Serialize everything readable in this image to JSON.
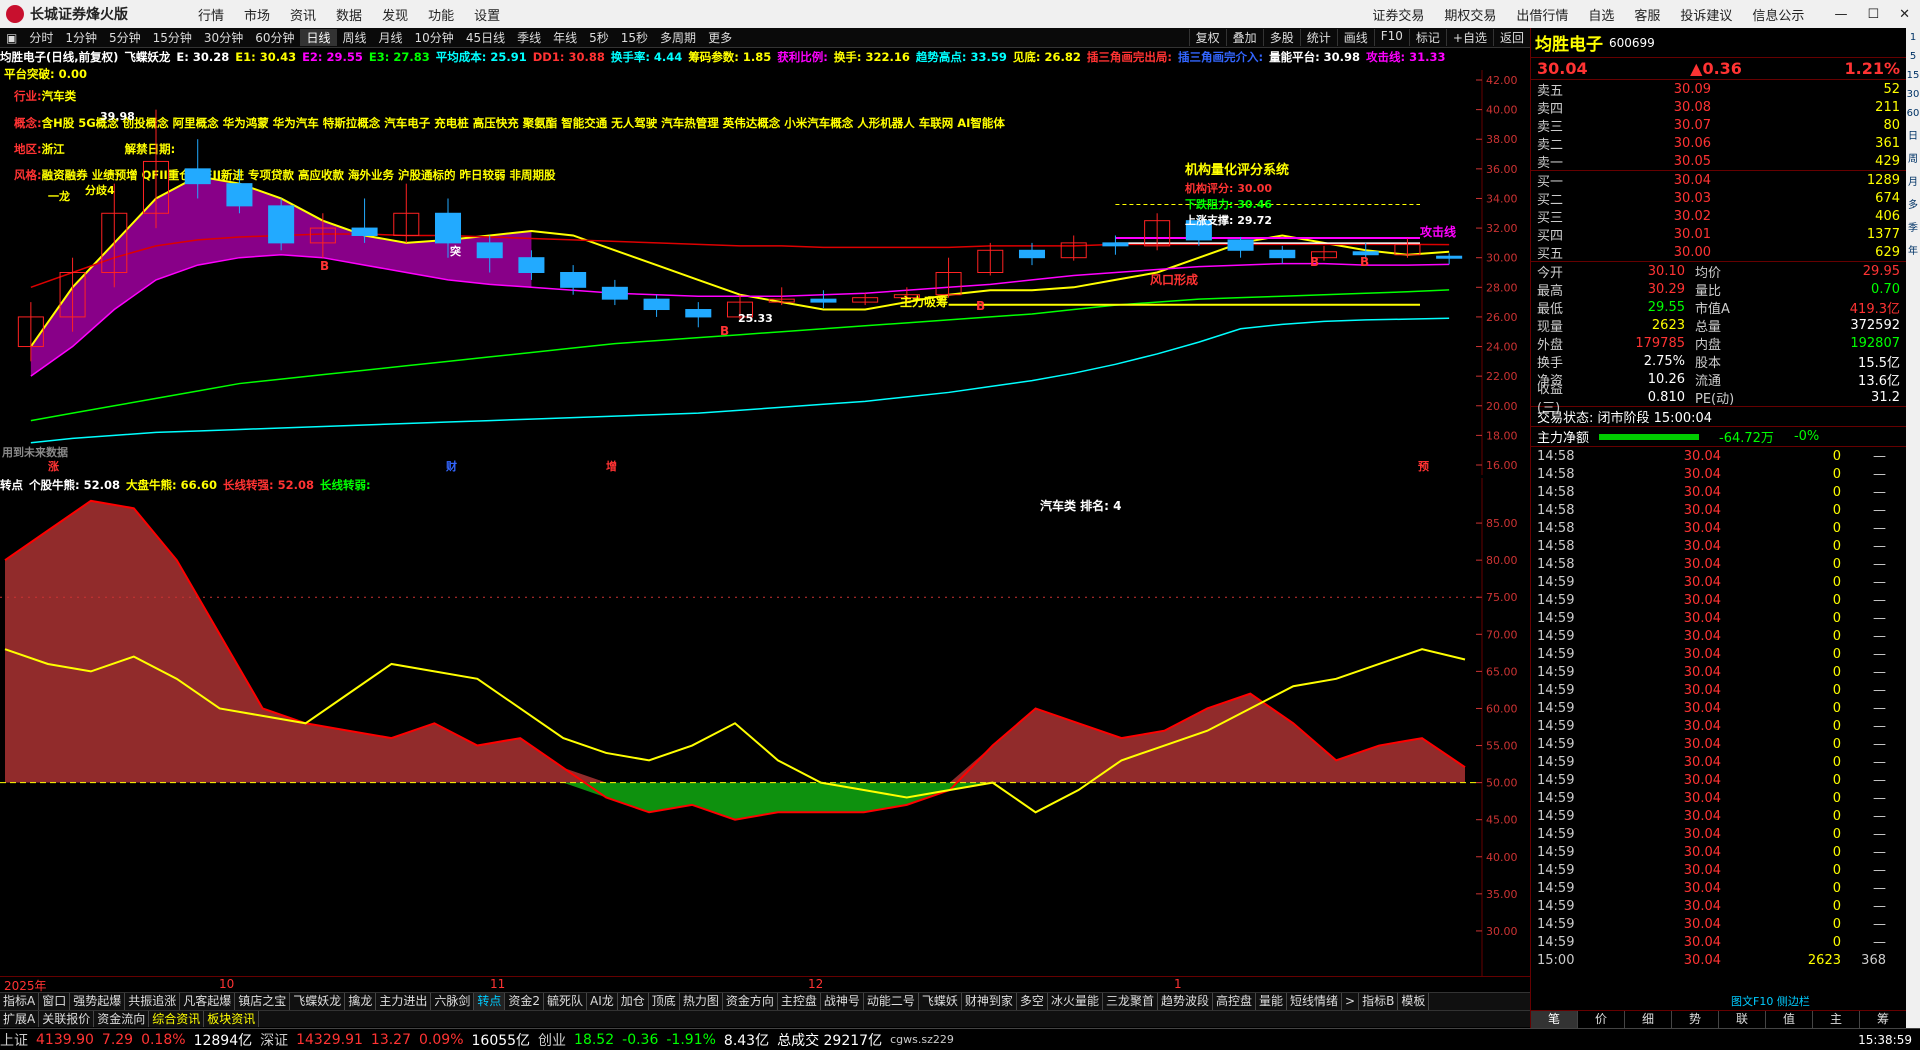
{
  "app": {
    "title": "长城证券烽火版"
  },
  "menu": [
    "行情",
    "市场",
    "资讯",
    "数据",
    "发现",
    "功能",
    "设置"
  ],
  "menu_right": [
    "证券交易",
    "期权交易",
    "出借行情",
    "自选",
    "客服",
    "投诉建议",
    "信息公示"
  ],
  "periods": [
    "分时",
    "1分钟",
    "5分钟",
    "15分钟",
    "30分钟",
    "60分钟",
    "日线",
    "周线",
    "月线",
    "10分钟",
    "45日线",
    "季线",
    "年线",
    "5秒",
    "15秒",
    "多周期",
    "更多"
  ],
  "active_period": "日线",
  "toolbar_right": [
    "复权",
    "叠加",
    "多股",
    "统计",
    "画线",
    "F10",
    "标记",
    "+自选",
    "返回"
  ],
  "indicator_line": [
    {
      "t": "均胜电子(日线,前复权)",
      "c": "#fff"
    },
    {
      "t": "飞蝶妖龙",
      "c": "#fff"
    },
    {
      "t": "E: 30.28",
      "c": "#fff"
    },
    {
      "t": "E1: 30.43",
      "c": "#ff0"
    },
    {
      "t": "E2: 29.55",
      "c": "#f0f"
    },
    {
      "t": "E3: 27.83",
      "c": "#0f0"
    },
    {
      "t": "平均成本: 25.91",
      "c": "#0ff"
    },
    {
      "t": "DD1: 30.88",
      "c": "#f33"
    },
    {
      "t": "换手率: 4.44",
      "c": "#0ff"
    },
    {
      "t": "筹码参数: 1.85",
      "c": "#ff0"
    },
    {
      "t": "获利比例:",
      "c": "#f0f"
    },
    {
      "t": "换手: 322.16",
      "c": "#ff0"
    },
    {
      "t": "趋势高点: 33.59",
      "c": "#0ff"
    },
    {
      "t": "见底: 26.82",
      "c": "#ff0"
    },
    {
      "t": "插三角画完出局:",
      "c": "#f33"
    },
    {
      "t": "插三角画完介入:",
      "c": "#36f"
    },
    {
      "t": "量能平台: 30.98",
      "c": "#fff"
    },
    {
      "t": "攻击线: 31.33",
      "c": "#f0f"
    }
  ],
  "platform": "平台突破: 0.00",
  "info": {
    "industry_k": "行业:",
    "industry_v": "汽车类",
    "concept_k": "概念:",
    "concept_v": "含H股 5G概念 创投概念 阿里概念 华为鸿蒙 华为汽车 特斯拉概念 汽车电子 充电桩 高压快充 聚氨酯 智能交通 无人驾驶 汽车热管理 英伟达概念 小米汽车概念 人形机器人 车联网 AI智能体",
    "region_k": "地区:",
    "region_v": "浙江",
    "release_k": "解禁日期:",
    "style_k": "风格:",
    "style_v": "融资融券 业绩预增 QFII重仓 QFII新进 专项贷款 高应收款 海外业务 沪股通标的 昨日较弱 非周期股"
  },
  "chart_labels": {
    "system": "机构量化评分系统",
    "score": "机构评分: 30.00",
    "resist": "下跌阻力: 30.46",
    "support": "上涨支撑: 29.72",
    "attack": "攻击线",
    "fengkou": "风口形成",
    "zhuli": "主力吸筹",
    "low": "25.33",
    "high": "39.98",
    "fenqi": "分歧4",
    "dragon": "一龙",
    "tu": "突",
    "future": "用到未来数据",
    "zhang": "涨",
    "cai": "财",
    "zeng": "增",
    "yu": "预",
    "b": "B"
  },
  "sub_header": [
    {
      "t": "转点",
      "c": "#fff"
    },
    {
      "t": "个股牛熊: 52.08",
      "c": "#fff"
    },
    {
      "t": "大盘牛熊: 66.60",
      "c": "#ff0"
    },
    {
      "t": "长线转强: 52.08",
      "c": "#f33"
    },
    {
      "t": "长线转弱:",
      "c": "#0f0"
    }
  ],
  "rank": "汽车类    排名: 4",
  "dates": [
    {
      "t": "2025年",
      "x": 0
    },
    {
      "t": "10",
      "x": 215
    },
    {
      "t": "11",
      "x": 486
    },
    {
      "t": "12",
      "x": 804
    },
    {
      "t": "1",
      "x": 1170
    }
  ],
  "tabs": [
    "指标A",
    "窗口",
    "强势起爆",
    "共振追涨",
    "凡客起爆",
    "镇店之宝",
    "飞蝶妖龙",
    "擒龙",
    "主力进出",
    "六脉剑",
    "转点",
    "资金2",
    "毓死队",
    "AI龙",
    "加仓",
    "顶底",
    "热力图",
    "资金方向",
    "主控盘",
    "战神号",
    "动能二号",
    "飞蝶妖",
    "财神到家",
    "多空",
    "冰火量能",
    "三龙聚首",
    "趋势波段",
    "高控盘",
    "量能",
    "短线情绪"
  ],
  "active_tab": "转点",
  "tabs_end": [
    "指标B",
    "模板"
  ],
  "tabs2": [
    "扩展A",
    "关联报价",
    "资金流向",
    "综合资讯",
    "板块资讯"
  ],
  "tab_period": "日线",
  "status": {
    "sh_l": "上证",
    "sh_v": "4139.90",
    "sh_c": "7.29",
    "sh_p": "0.18%",
    "sh_a": "12894亿",
    "sz_l": "深证",
    "sz_v": "14329.91",
    "sz_c": "13.27",
    "sz_p": "0.09%",
    "sz_a": "16055亿",
    "cy_l": "创业",
    "cy_v": "18.52",
    "cy_c": "-0.36",
    "cy_p": "-1.91%",
    "cy_a": "8.43亿",
    "total": "总成交 29217亿",
    "server": "cgws.sz229",
    "time": "15:38:59"
  },
  "quote": {
    "name": "均胜电子",
    "code": "600699",
    "price": "30.04",
    "change": "▲0.36",
    "pct": "1.21%",
    "asks": [
      [
        "卖五",
        "30.09",
        "52"
      ],
      [
        "卖四",
        "30.08",
        "211"
      ],
      [
        "卖三",
        "30.07",
        "80"
      ],
      [
        "卖二",
        "30.06",
        "361"
      ],
      [
        "卖一",
        "30.05",
        "429"
      ]
    ],
    "bids": [
      [
        "买一",
        "30.04",
        "1289"
      ],
      [
        "买二",
        "30.03",
        "674"
      ],
      [
        "买三",
        "30.02",
        "406"
      ],
      [
        "买四",
        "30.01",
        "1377"
      ],
      [
        "买五",
        "30.00",
        "629"
      ]
    ],
    "stats": [
      [
        "今开",
        "30.10",
        "均价",
        "29.95"
      ],
      [
        "最高",
        "30.29",
        "量比",
        "0.70"
      ],
      [
        "最低",
        "29.55",
        "市值A",
        "419.3亿"
      ],
      [
        "现量",
        "2623",
        "总量",
        "372592"
      ],
      [
        "外盘",
        "179785",
        "内盘",
        "192807"
      ],
      [
        "换手",
        "2.75%",
        "股本",
        "15.5亿"
      ],
      [
        "净资",
        "10.26",
        "流通",
        "13.6亿"
      ],
      [
        "收益(三)",
        "0.810",
        "PE(动)",
        "31.2"
      ]
    ],
    "trade_state": "交易状态:  闭市阶段  15:00:04",
    "flow_label": "主力净额",
    "flow_v": "-64.72万",
    "flow_p": "-0%",
    "ticks": [
      [
        "14:58",
        "30.04",
        "0",
        "—"
      ],
      [
        "14:58",
        "30.04",
        "0",
        "—"
      ],
      [
        "14:58",
        "30.04",
        "0",
        "—"
      ],
      [
        "14:58",
        "30.04",
        "0",
        "—"
      ],
      [
        "14:58",
        "30.04",
        "0",
        "—"
      ],
      [
        "14:58",
        "30.04",
        "0",
        "—"
      ],
      [
        "14:58",
        "30.04",
        "0",
        "—"
      ],
      [
        "14:59",
        "30.04",
        "0",
        "—"
      ],
      [
        "14:59",
        "30.04",
        "0",
        "—"
      ],
      [
        "14:59",
        "30.04",
        "0",
        "—"
      ],
      [
        "14:59",
        "30.04",
        "0",
        "—"
      ],
      [
        "14:59",
        "30.04",
        "0",
        "—"
      ],
      [
        "14:59",
        "30.04",
        "0",
        "—"
      ],
      [
        "14:59",
        "30.04",
        "0",
        "—"
      ],
      [
        "14:59",
        "30.04",
        "0",
        "—"
      ],
      [
        "14:59",
        "30.04",
        "0",
        "—"
      ],
      [
        "14:59",
        "30.04",
        "0",
        "—"
      ],
      [
        "14:59",
        "30.04",
        "0",
        "—"
      ],
      [
        "14:59",
        "30.04",
        "0",
        "—"
      ],
      [
        "14:59",
        "30.04",
        "0",
        "—"
      ],
      [
        "14:59",
        "30.04",
        "0",
        "—"
      ],
      [
        "14:59",
        "30.04",
        "0",
        "—"
      ],
      [
        "14:59",
        "30.04",
        "0",
        "—"
      ],
      [
        "14:59",
        "30.04",
        "0",
        "—"
      ],
      [
        "14:59",
        "30.04",
        "0",
        "—"
      ],
      [
        "14:59",
        "30.04",
        "0",
        "—"
      ],
      [
        "14:59",
        "30.04",
        "0",
        "—"
      ],
      [
        "14:59",
        "30.04",
        "0",
        "—"
      ],
      [
        "15:00",
        "30.04",
        "2623",
        "368"
      ]
    ],
    "tabs": [
      "笔",
      "价",
      "细",
      "势",
      "联",
      "值",
      "主",
      "筹"
    ],
    "f10": "图文F10 侧边栏"
  },
  "side_labels": [
    "1",
    "5",
    "15",
    "30",
    "60",
    "日",
    "周",
    "月",
    "多",
    "季",
    "年"
  ],
  "chart_data": [
    {
      "type": "line",
      "title": "均胜电子(日线,前复权)",
      "ylim": [
        16,
        42
      ],
      "yticks": [
        16,
        18,
        20,
        22,
        24,
        26,
        28,
        30,
        32,
        34,
        36,
        38,
        40,
        42
      ],
      "series": [
        {
          "name": "E1",
          "color": "#ff0",
          "values": [
            24,
            28,
            31,
            34,
            35.5,
            35,
            34,
            32.5,
            31.5,
            31,
            31.2,
            31.5,
            31.8,
            31.5,
            30.5,
            29.5,
            28.5,
            27.5,
            27,
            26.5,
            26.5,
            27,
            27.5,
            27.8,
            27.8,
            28,
            28.5,
            29,
            30,
            31,
            31.5,
            31,
            30.5,
            30.2,
            30.4
          ]
        },
        {
          "name": "E2",
          "color": "#f0f",
          "values": [
            22,
            24,
            26.5,
            28.5,
            29.5,
            30,
            30.2,
            30,
            29.5,
            29,
            28.5,
            28.2,
            28,
            27.8,
            27.6,
            27.5,
            27.4,
            27.4,
            27.4,
            27.5,
            27.6,
            27.8,
            28,
            28.2,
            28.5,
            28.8,
            29,
            29.2,
            29.4,
            29.5,
            29.6,
            29.6,
            29.5,
            29.5,
            29.55
          ]
        },
        {
          "name": "E3",
          "color": "#0f0",
          "values": [
            19,
            19.5,
            20,
            20.5,
            21,
            21.5,
            21.8,
            22.1,
            22.4,
            22.7,
            23,
            23.3,
            23.6,
            23.9,
            24.2,
            24.4,
            24.6,
            24.8,
            25,
            25.2,
            25.4,
            25.6,
            25.8,
            26,
            26.2,
            26.5,
            26.8,
            27,
            27.2,
            27.3,
            27.4,
            27.5,
            27.6,
            27.7,
            27.83
          ]
        },
        {
          "name": "平均成本",
          "color": "#0ff",
          "values": [
            17.5,
            17.8,
            18,
            18.2,
            18.3,
            18.4,
            18.5,
            18.6,
            18.7,
            18.8,
            18.9,
            19,
            19.1,
            19.2,
            19.3,
            19.4,
            19.5,
            19.7,
            19.9,
            20.1,
            20.3,
            20.6,
            20.9,
            21.3,
            21.7,
            22.2,
            22.8,
            23.5,
            24.3,
            25.2,
            25.5,
            25.7,
            25.8,
            25.85,
            25.91
          ]
        },
        {
          "name": "DD1",
          "color": "#d00",
          "values": [
            28,
            29,
            30,
            30.8,
            31.2,
            31.4,
            31.5,
            31.6,
            31.6,
            31.5,
            31.5,
            31.4,
            31.3,
            31.2,
            31.1,
            31,
            30.9,
            30.8,
            30.8,
            30.7,
            30.7,
            30.7,
            30.7,
            30.8,
            30.8,
            30.8,
            30.9,
            30.9,
            30.9,
            30.9,
            30.9,
            30.9,
            30.9,
            30.9,
            30.88
          ]
        }
      ],
      "candles": [
        [
          24,
          26,
          27,
          23
        ],
        [
          26,
          29,
          30,
          25
        ],
        [
          29,
          33,
          35,
          28
        ],
        [
          33,
          36.5,
          40,
          32
        ],
        [
          36,
          35,
          38,
          34
        ],
        [
          35,
          33.5,
          36,
          33
        ],
        [
          33.5,
          31,
          34,
          30.5
        ],
        [
          31,
          32,
          33,
          30
        ],
        [
          32,
          31.5,
          34,
          31
        ],
        [
          31.5,
          33,
          35,
          31
        ],
        [
          33,
          31,
          34,
          30
        ],
        [
          31,
          30,
          31.5,
          29
        ],
        [
          30,
          29,
          30.5,
          28.5
        ],
        [
          29,
          28,
          29.5,
          27.5
        ],
        [
          28,
          27.2,
          28.5,
          26.8
        ],
        [
          27.2,
          26.5,
          27.5,
          26
        ],
        [
          26.5,
          26,
          27,
          25.3
        ],
        [
          26,
          27,
          27.5,
          25.8
        ],
        [
          27,
          27.2,
          28,
          26.8
        ],
        [
          27.2,
          27,
          27.8,
          26.6
        ],
        [
          27,
          27.3,
          27.6,
          26.8
        ],
        [
          27.3,
          27.5,
          28,
          27
        ],
        [
          27.5,
          29,
          30,
          27.3
        ],
        [
          29,
          30.5,
          31,
          28.8
        ],
        [
          30.5,
          30,
          31,
          29.5
        ],
        [
          30,
          31,
          31.5,
          29.8
        ],
        [
          31,
          30.8,
          31.5,
          30.2
        ],
        [
          30.8,
          32.5,
          33,
          30.5
        ],
        [
          32.5,
          31.2,
          32.8,
          30.8
        ],
        [
          31.2,
          30.5,
          31.4,
          30
        ],
        [
          30.5,
          30,
          30.8,
          29.6
        ],
        [
          30,
          30.4,
          30.8,
          29.8
        ],
        [
          30.4,
          30.2,
          31,
          29.9
        ],
        [
          30.2,
          30.9,
          31.3,
          30
        ],
        [
          30.1,
          30.04,
          30.29,
          29.55
        ]
      ]
    },
    {
      "type": "area",
      "title": "转点",
      "ylim": [
        25,
        90
      ],
      "yticks": [
        30,
        35,
        40,
        45,
        50,
        55,
        60,
        65,
        70,
        75,
        80,
        85
      ],
      "baseline": 50,
      "series": [
        {
          "name": "个股牛熊",
          "color": "#f00",
          "values": [
            80,
            84,
            88,
            87,
            80,
            70,
            60,
            58,
            57,
            56,
            58,
            55,
            56,
            52,
            48,
            46,
            47,
            45,
            46,
            46,
            46,
            47,
            49,
            55,
            60,
            58,
            56,
            57,
            60,
            62,
            58,
            53,
            55,
            56,
            52.08
          ]
        },
        {
          "name": "大盘牛熊",
          "color": "#ff0",
          "values": [
            68,
            66,
            65,
            67,
            64,
            60,
            59,
            58,
            62,
            66,
            65,
            64,
            60,
            56,
            54,
            53,
            55,
            58,
            53,
            50,
            49,
            48,
            49,
            50,
            46,
            49,
            53,
            55,
            57,
            60,
            63,
            64,
            66,
            68,
            66.6
          ]
        }
      ]
    }
  ]
}
